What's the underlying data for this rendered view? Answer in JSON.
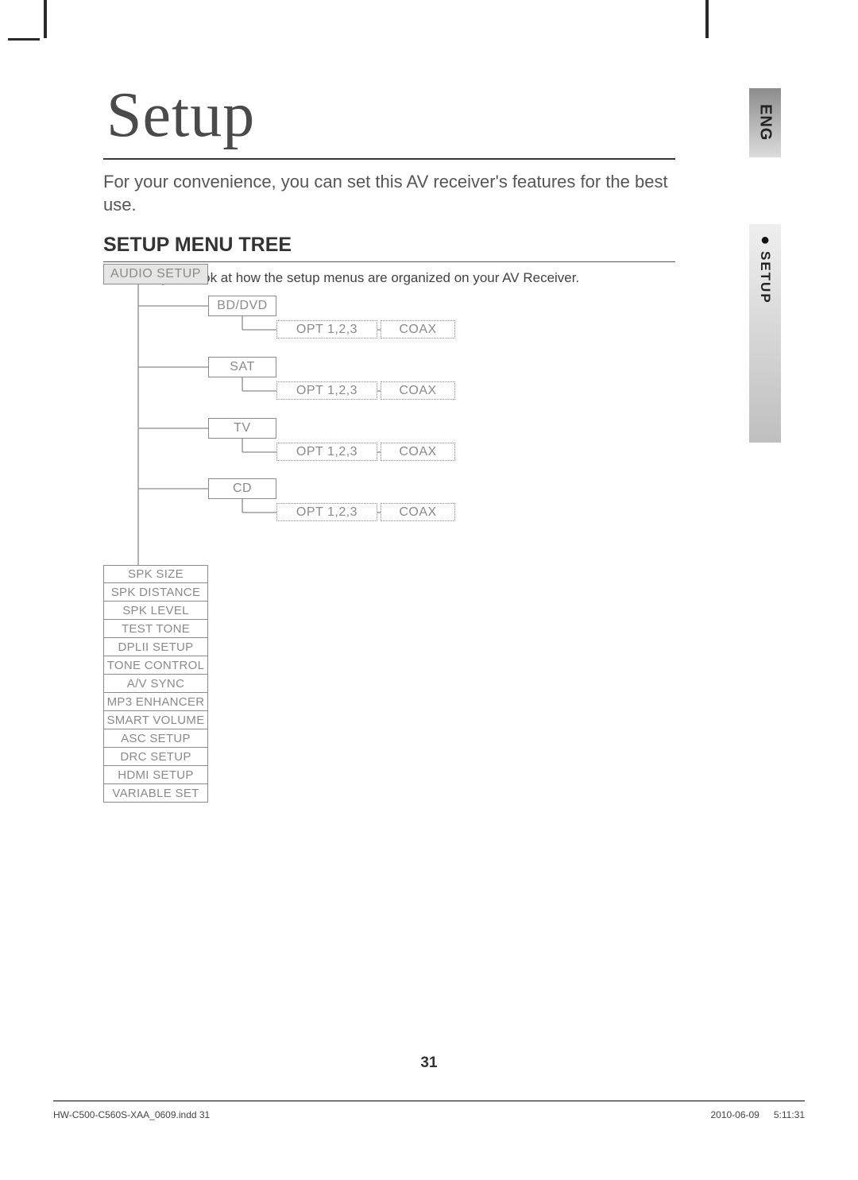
{
  "sidebar": {
    "language": "ENG",
    "section_bullet": "●",
    "section_label": "SETUP"
  },
  "header": {
    "title": "Setup",
    "intro": "For your convenience, you can set this AV receiver's features for the best use.",
    "section_heading": "SETUP MENU TREE",
    "section_para": "Here's a quick look at how the setup menus are organized on your AV Receiver."
  },
  "tree": {
    "root": "AUDIO SETUP",
    "devices": [
      {
        "name": "BD/DVD",
        "opt": "OPT 1,2,3",
        "coax": "COAX"
      },
      {
        "name": "SAT",
        "opt": "OPT 1,2,3",
        "coax": "COAX"
      },
      {
        "name": "TV",
        "opt": "OPT 1,2,3",
        "coax": "COAX"
      },
      {
        "name": "CD",
        "opt": "OPT 1,2,3",
        "coax": "COAX"
      }
    ],
    "setup_items": [
      "SPK SIZE",
      "SPK DISTANCE",
      "SPK LEVEL",
      "TEST TONE",
      "DPLII SETUP",
      "TONE CONTROL",
      "A/V SYNC",
      "MP3 ENHANCER",
      "SMART VOLUME",
      "ASC SETUP",
      "DRC SETUP",
      "HDMI SETUP",
      "VARIABLE SET"
    ]
  },
  "page_number": "31",
  "footer": {
    "file": "HW-C500-C560S-XAA_0609.indd   31",
    "date": "2010-06-09",
    "time": "5:11:31"
  }
}
